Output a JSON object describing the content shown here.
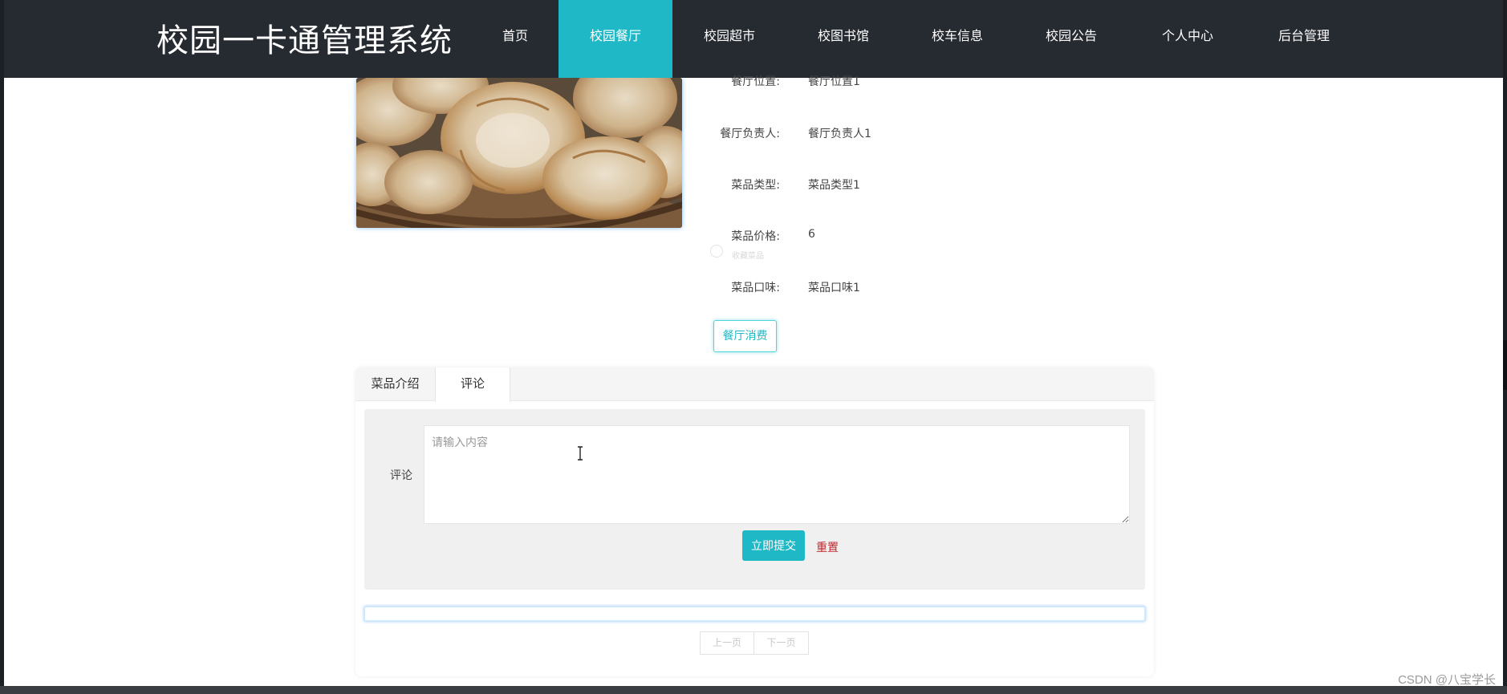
{
  "header": {
    "logo": "校园一卡通管理系统",
    "nav": [
      {
        "label": "首页",
        "active": false
      },
      {
        "label": "校园餐厅",
        "active": true
      },
      {
        "label": "校园超市",
        "active": false
      },
      {
        "label": "校图书馆",
        "active": false
      },
      {
        "label": "校车信息",
        "active": false
      },
      {
        "label": "校园公告",
        "active": false
      },
      {
        "label": "个人中心",
        "active": false
      },
      {
        "label": "后台管理",
        "active": false
      }
    ],
    "accent_color": "#1eb8c6",
    "background_color": "#262a31"
  },
  "details": {
    "image": "flatbread-photo",
    "fields": [
      {
        "label": "餐厅位置:",
        "value": "餐厅位置1"
      },
      {
        "label": "餐厅负责人:",
        "value": "餐厅负责人1"
      },
      {
        "label": "菜品类型:",
        "value": "菜品类型1"
      },
      {
        "label": "菜品价格:",
        "value": "6"
      },
      {
        "label": "菜品口味:",
        "value": "菜品口味1"
      }
    ],
    "faint_hint": "收藏菜品",
    "consume_button": "餐厅消费"
  },
  "tabs": [
    {
      "label": "菜品介绍",
      "active": false
    },
    {
      "label": "评论",
      "active": true
    }
  ],
  "comment_form": {
    "label": "评论",
    "placeholder": "请输入内容",
    "value": "",
    "submit_label": "立即提交",
    "reset_label": "重置"
  },
  "pagination": {
    "prev_label": "上一页",
    "next_label": "下一页"
  },
  "watermark": "CSDN @八宝学长"
}
